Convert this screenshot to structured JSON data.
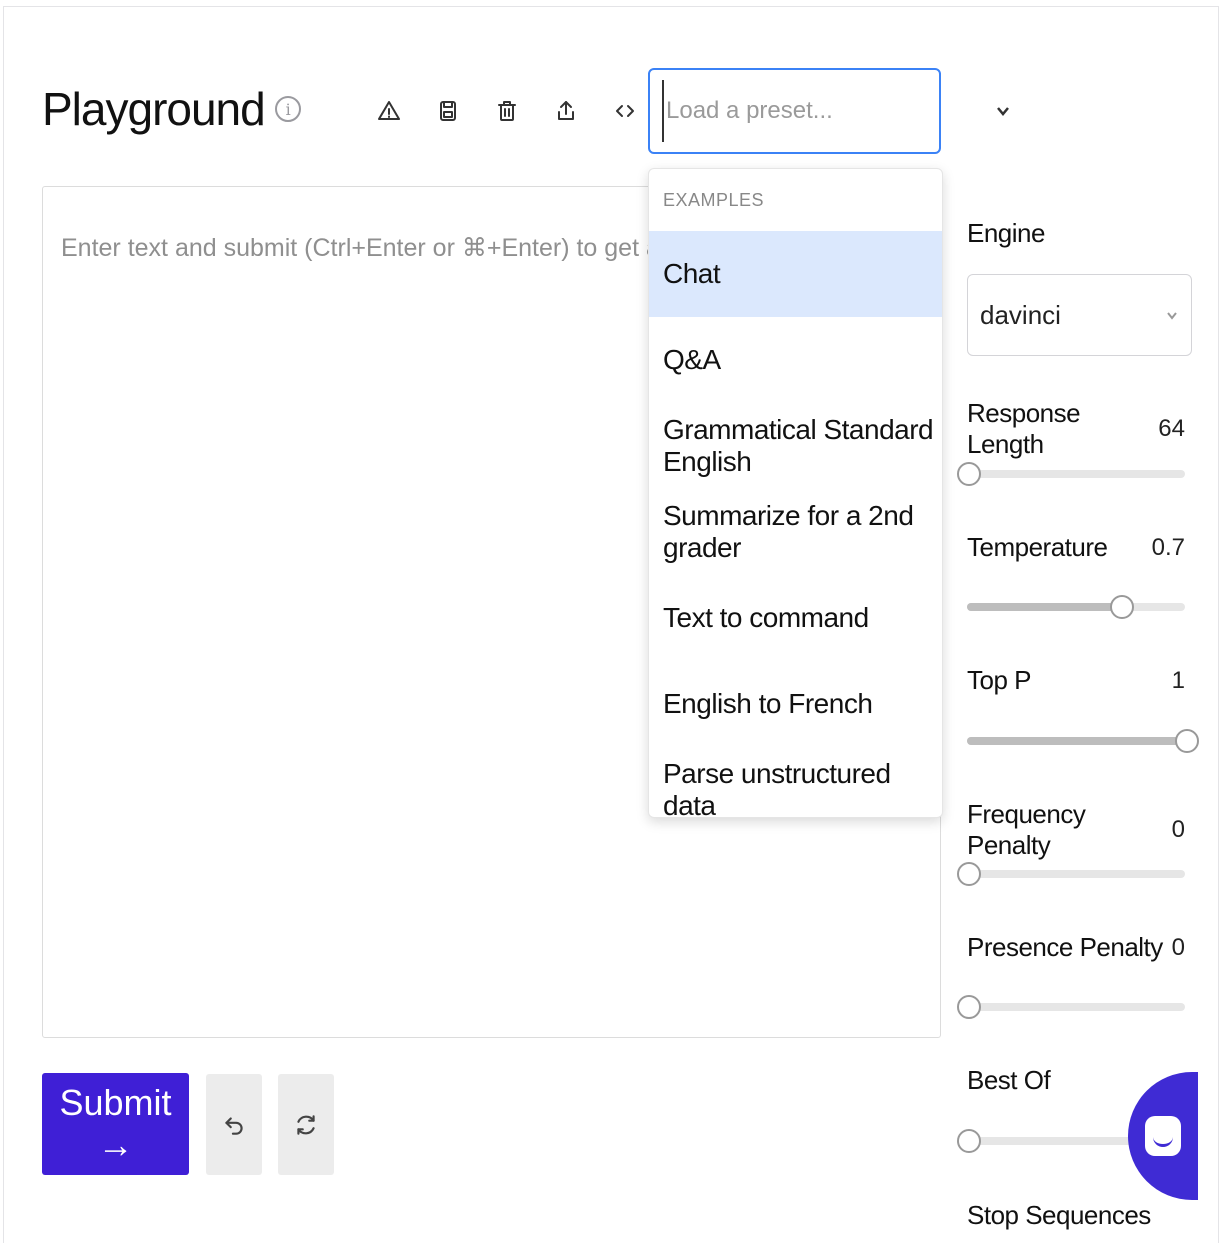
{
  "header": {
    "title": "Playground",
    "info_icon": "info-icon"
  },
  "toolbar": {
    "icons": [
      "warning-icon",
      "save-icon",
      "trash-icon",
      "share-icon",
      "code-icon"
    ]
  },
  "preset": {
    "placeholder": "Load a preset...",
    "menu_group": "EXAMPLES",
    "items": [
      "Chat",
      "Q&A",
      "Grammatical Standard English",
      "Summarize for a 2nd grader",
      "Text to command",
      "English to French",
      "Parse unstructured data"
    ],
    "highlighted": "Chat"
  },
  "editor": {
    "placeholder": "Enter text and submit (Ctrl+Enter or ⌘+Enter) to get a completion."
  },
  "actions": {
    "submit_label": "Submit →",
    "undo_icon": "undo-icon",
    "regenerate_icon": "regenerate-icon"
  },
  "settings": {
    "engine_label": "Engine",
    "engine_value": "davinci",
    "response_length_label": "Response Length",
    "response_length_value": "64",
    "response_length_level": 0.0,
    "temperature_label": "Temperature",
    "temperature_value": "0.7",
    "temperature_level": 0.7,
    "top_p_label": "Top P",
    "top_p_value": "1",
    "top_p_level": 1.0,
    "frequency_penalty_label": "Frequency Penalty",
    "frequency_penalty_value": "0",
    "frequency_penalty_level": 0.0,
    "presence_penalty_label": "Presence Penalty",
    "presence_penalty_value": "0",
    "presence_penalty_level": 0.0,
    "best_of_label": "Best Of",
    "best_of_level": 0.0,
    "stop_sequences_label": "Stop Sequences"
  },
  "colors": {
    "accent": "#3f1fd6",
    "focus_border": "#3b82f6",
    "menu_highlight": "#dbe8fd"
  }
}
